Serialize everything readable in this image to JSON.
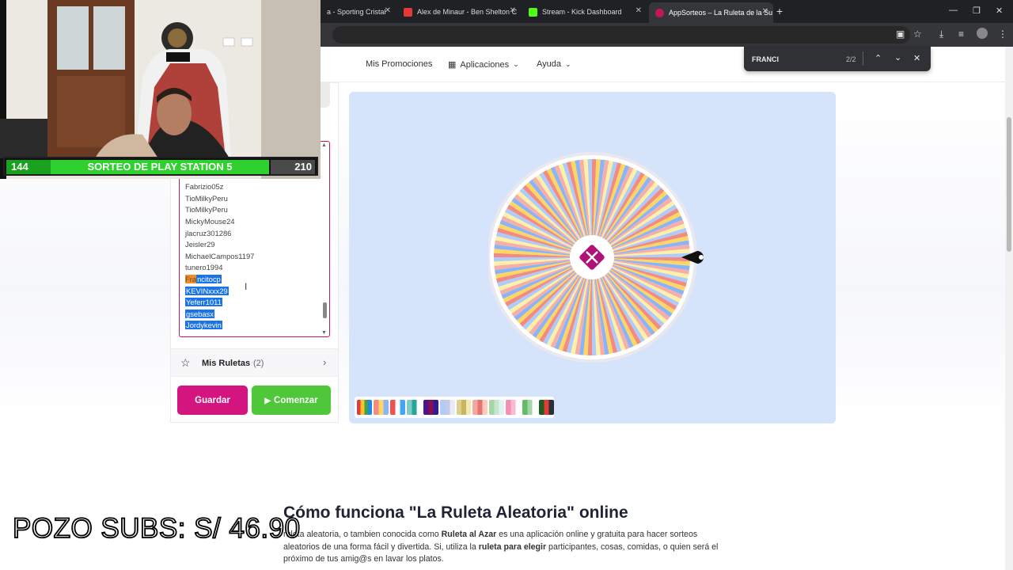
{
  "browser": {
    "tabs": [
      {
        "title": "a - Sporting Cristal",
        "favicon_color": "#3a3a3a"
      },
      {
        "title": "Alex de Minaur - Ben Shelton C",
        "favicon_color": "#e53935"
      },
      {
        "title": "Stream - Kick Dashboard",
        "favicon_color": "#53fc18"
      },
      {
        "title": "AppSorteos – La Ruleta de la Su",
        "favicon_color": "#c2185b"
      }
    ],
    "new_tab": "+",
    "find": {
      "query": "FRANCI",
      "count": "2/2"
    }
  },
  "nav": {
    "promos": "Mis Promociones",
    "apps": "Aplicaciones",
    "help": "Ayuda"
  },
  "entries": {
    "names": [
      "Fabrizio05z",
      "TioMilkyPeru",
      "TioMilkyPeru",
      "MickyMouse24",
      "jlacruz301286",
      "Jeisler29",
      "MichaelCampos1197",
      "tunero1994"
    ],
    "selected_prefix": "Fra",
    "selected_rest": "ncitocp",
    "selected_names": [
      "KEVINxxx29",
      "Yeferr1011",
      "gsebasx",
      "Jordykevin"
    ]
  },
  "mis_ruletas": {
    "label": "Mis Ruletas",
    "count": "(2)"
  },
  "buttons": {
    "save": "Guardar",
    "start": "Comenzar"
  },
  "wheel": {
    "segment_colors": [
      "#f28b82",
      "#fdd663",
      "#8ab4f8",
      "#f6aea9",
      "#fff0a8",
      "#aecbfa"
    ],
    "segments": 144,
    "center_color": "#b0127a"
  },
  "palettes": [
    [
      "#e53935",
      "#fbc02d",
      "#43a047",
      "#1e88e5"
    ],
    [
      "#f28b82",
      "#fdd663",
      "#8ab4f8"
    ],
    [
      "#ef5350",
      "#ffffff",
      "#42a5f5"
    ],
    [
      "#80cbc4",
      "#26a69a",
      "#ffffff"
    ],
    [
      "#4a148c",
      "#880e4f",
      "#311b92"
    ],
    [
      "#aecbfa",
      "#c5cae9",
      "#e8eaf6"
    ],
    [
      "#dcd08a",
      "#c8b560",
      "#f2e9b0"
    ],
    [
      "#f4a7a0",
      "#e57373",
      "#ffccbc"
    ],
    [
      "#a5d6a7",
      "#c8e6c9",
      "#e0f2f1"
    ],
    [
      "#f48fb1",
      "#f8bbd0",
      "#ffffff"
    ],
    [
      "#66bb6a",
      "#a5d6a7",
      "#ffffff"
    ],
    [
      "#1b5e20",
      "#e53935",
      "#263238"
    ]
  ],
  "article": {
    "title": "Cómo funciona \"La Ruleta Aleatoria\" online",
    "p1": "ruleta aleatoria, o tambien conocida como ",
    "b1": "Ruleta al Azar",
    "p2": " es una aplicación online y gratuita para hacer sorteos aleatorios de una forma fácil y divertida. Si, utiliza la ",
    "b2": "ruleta para elegir",
    "p3": " participantes, cosas, comidas, o quien será el próximo de tus amig@s en lavar los platos."
  },
  "overlay": {
    "left_number": "144",
    "banner_title": "SORTEO DE PLAY STATION 5",
    "right_number": "210",
    "pozo": "POZO SUBS: S/ 46.90"
  }
}
